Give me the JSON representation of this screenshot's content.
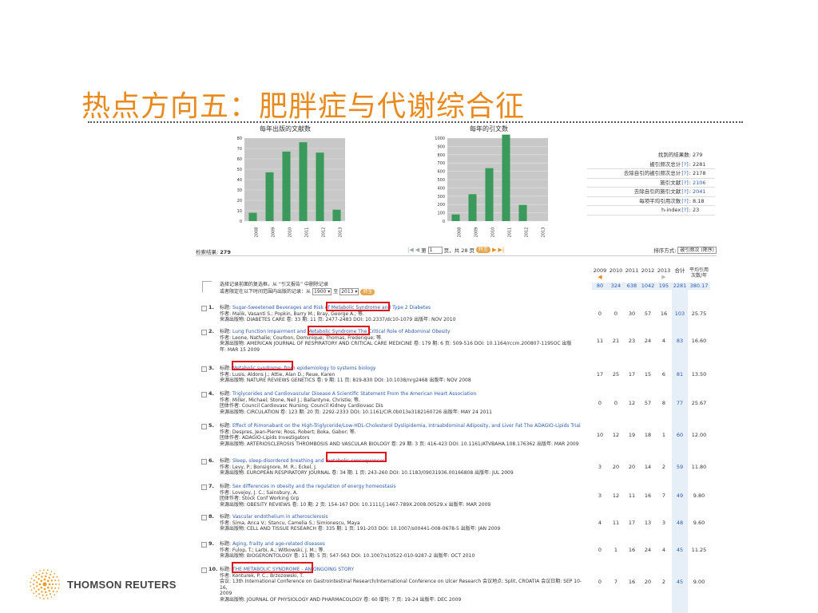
{
  "slide": {
    "title": "热点方向五：肥胖症与代谢综合征"
  },
  "charts": {
    "pubs_title": "每年出版的文献数",
    "cites_title": "每年的引文数"
  },
  "chart_data": [
    {
      "type": "bar",
      "title": "每年出版的文献数",
      "categories": [
        "2008",
        "2009",
        "2010",
        "2011",
        "2012",
        "2013"
      ],
      "values": [
        8,
        47,
        67,
        76,
        66,
        11
      ],
      "ylim": [
        0,
        80
      ],
      "yticks": [
        0,
        10,
        20,
        30,
        40,
        50,
        60,
        70,
        80
      ],
      "color": "#3A9A5B",
      "grid": true
    },
    {
      "type": "bar",
      "title": "每年的引文数",
      "categories": [
        "2008",
        "2009",
        "2010",
        "2011",
        "2012",
        "2013"
      ],
      "values": [
        80,
        324,
        638,
        1042,
        195,
        0
      ],
      "ylim": [
        0,
        1000
      ],
      "yticks": [
        0,
        100,
        200,
        300,
        400,
        500,
        600,
        700,
        800,
        900,
        1000
      ],
      "color": "#3A9A5B",
      "grid": true
    }
  ],
  "stats": [
    {
      "label": "找到的结果数",
      "q": false,
      "value": "279",
      "link": false
    },
    {
      "label": "被引频次总计",
      "q": true,
      "value": "2281",
      "link": false
    },
    {
      "label": "去除自引的被引频次总计",
      "q": true,
      "value": "2178",
      "link": false
    },
    {
      "label": "施引文献",
      "q": true,
      "value": "2106",
      "link": true
    },
    {
      "label": "去除自引的施引文献",
      "q": true,
      "value": "2041",
      "link": true
    },
    {
      "label": "每项平均引用次数",
      "q": true,
      "value": "8.18",
      "link": false
    },
    {
      "label": "h-index",
      "q": true,
      "value": "23",
      "link": false
    }
  ],
  "stats_q": "[?]",
  "toolbar": {
    "results_label": "检索结果:",
    "results_count": "279",
    "page_label": "第",
    "page_value": "1",
    "page_suffix": "页，共 28 页",
    "go_label": "转至",
    "sort_label": "排序方式:",
    "sort_value": "被引频次 (降序)"
  },
  "header": {
    "line1": "选择记录前面的复选框，从 “引文报告” 中删除记录",
    "line2a": "或者限定在以下时间范围内出版的记录：从",
    "from_year": "1900",
    "line2b": "至",
    "to_year": "2013",
    "go": "转至"
  },
  "years": [
    "2009",
    "2010",
    "2011",
    "2012",
    "2013",
    "合计",
    "平均引用次数/年"
  ],
  "year_totals": [
    "80",
    "324",
    "638",
    "1042",
    "195",
    "2281",
    "380.17"
  ],
  "records": [
    {
      "num": "1.",
      "title_label": "标题:",
      "title": "Sugar-Sweetened Beverages and Risk of Metabolic Syndrome and Type 2 Diabetes",
      "lines": [
        "作者: Malik, Vasanti S.; Popkin, Barry M.; Bray, George A.; 等.",
        "来源出版物: DIABETES CARE 卷: 33 期: 11 页: 2477-2483 DOI: 10.2337/dc10-1079 出版年: NOV 2010"
      ],
      "counts": [
        "0",
        "0",
        "30",
        "57",
        "16",
        "103",
        "25.75"
      ]
    },
    {
      "num": "2.",
      "title_label": "标题:",
      "title": "Lung Function Impairment and Metabolic Syndrome The Critical Role of Abdominal Obesity",
      "lines": [
        "作者: Leone, Nathalie; Courbon, Dominique; Thomas, Frederique; 等.",
        "来源出版物: AMERICAN JOURNAL OF RESPIRATORY AND CRITICAL CARE MEDICINE 卷: 179 期: 6 页: 509-516 DOI: 10.1164/rccm.200807-1195OC 出版",
        "年: MAR 15 2009"
      ],
      "counts": [
        "11",
        "21",
        "23",
        "24",
        "4",
        "83",
        "16.60"
      ]
    },
    {
      "num": "3.",
      "title_label": "标题:",
      "title": "Metabolic syndrome: from epidemiology to systems biology",
      "lines": [
        "作者: Lusis, Aldons J.; Attie, Alan D.; Reue, Karen",
        "来源出版物: NATURE REVIEWS GENETICS 卷: 9 期: 11 页: 819-830 DOI: 10.1038/nrg2468 出版年: NOV 2008"
      ],
      "counts": [
        "17",
        "25",
        "17",
        "15",
        "6",
        "81",
        "13.50"
      ]
    },
    {
      "num": "4.",
      "title_label": "标题:",
      "title": "Triglycerides and Cardiovascular Disease A Scientific Statement From the American Heart Association",
      "lines": [
        "作者: Miller, Michael; Stone, Neil J.; Ballantyne, Christie; 等.",
        "团体作者: Council Cardiovasc Nursing; Council Kidney Cardiovasc Dis",
        "来源出版物: CIRCULATION 卷: 123 期: 20 页: 2292-2333 DOI: 10.1161/CIR.0b013e3182160726 出版年: MAY 24 2011"
      ],
      "counts": [
        "0",
        "0",
        "12",
        "57",
        "8",
        "77",
        "25.67"
      ]
    },
    {
      "num": "5.",
      "title_label": "标题:",
      "title": "Effect of Rimonabant on the High-Triglyceride/Low-HDL-Cholesterol Dyslipidemia, Intraabdominal Adiposity, and Liver Fat The ADAGIO-Lipids Trial",
      "lines": [
        "作者: Despres, Jean-Pierre; Ross, Robert; Boka, Gabor; 等.",
        "团体作者: ADAGIO-Lipids Investigators",
        "来源出版物: ARTERIOSCLEROSIS THROMBOSIS AND VASCULAR BIOLOGY 卷: 29 期: 3 页: 416-423 DOI: 10.1161/ATVBAHA.108.176362 出版年: MAR 2009"
      ],
      "counts": [
        "10",
        "12",
        "19",
        "18",
        "1",
        "60",
        "12.00"
      ]
    },
    {
      "num": "6.",
      "title_label": "标题:",
      "title": "Sleep, sleep-disordered breathing and metabolic consequences",
      "lines": [
        "作者: Levy, P.; Bonsignore, M. R.; Eckel, J.",
        "来源出版物: EUROPEAN RESPIRATORY JOURNAL 卷: 34 期: 1 页: 243-260 DOI: 10.1183/09031936.00166808 出版年: JUL 2009"
      ],
      "counts": [
        "3",
        "20",
        "20",
        "14",
        "2",
        "59",
        "11.80"
      ]
    },
    {
      "num": "7.",
      "title_label": "标题:",
      "title": "Sex differences in obesity and the regulation of energy homeostasis",
      "lines": [
        "作者: Lovejoy, J. C.; Sainsbury, A.",
        "团体作者: Stock Conf Working Grp",
        "来源出版物: OBESITY REVIEWS 卷: 10 期: 2 页: 154-167 DOI: 10.1111/j.1467-789X.2008.00529.x 出版年: MAR 2009"
      ],
      "counts": [
        "3",
        "12",
        "11",
        "16",
        "7",
        "49",
        "9.80"
      ]
    },
    {
      "num": "8.",
      "title_label": "标题:",
      "title": "Vascular endothelium in atherosclerosis",
      "lines": [
        "作者: Sima, Anca V.; Stancu, Camelia S.; Simionescu, Maya",
        "来源出版物: CELL AND TISSUE RESEARCH 卷: 335 期: 1 页: 191-203 DOI: 10.1007/s00441-008-0678-5 出版年: JAN 2009"
      ],
      "counts": [
        "4",
        "11",
        "17",
        "13",
        "3",
        "48",
        "9.60"
      ]
    },
    {
      "num": "9.",
      "title_label": "标题:",
      "title": "Aging, frailty and age-related diseases",
      "lines": [
        "作者: Fulop, T.; Larbi, A.; Witkowski, J. M.; 等.",
        "来源出版物: BIOGERONTOLOGY 卷: 11 期: 5 页: 547-563 DOI: 10.1007/s10522-010-9287-2 出版年: OCT 2010"
      ],
      "counts": [
        "0",
        "1",
        "16",
        "24",
        "4",
        "45",
        "11.25"
      ]
    },
    {
      "num": "10.",
      "title_label": "标题:",
      "title": "THE METABOLIC SYNDROME - AN ONGOING STORY",
      "lines": [
        "作者: Konturek, P. C.; Brzozowski, T.",
        "会议: 13th International Conference on Gastrointestinal Research/International Conference on Ulcer Research 会议地点: Split, CROATIA 会议日期: SEP 10-16,",
        "2009",
        "来源出版物: JOURNAL OF PHYSIOLOGY AND PHARMACOLOGY 卷: 60 增刊: 7 页: 19-24 出版年: DEC 2009"
      ],
      "counts": [
        "0",
        "7",
        "16",
        "20",
        "2",
        "45",
        "9.00"
      ]
    }
  ],
  "logo": {
    "text": "THOMSON REUTERS"
  },
  "colors": {
    "title": "#E98A1E",
    "bar": "#3A9A5B",
    "link": "#2D5DB3",
    "highlight": "#E0161D"
  }
}
